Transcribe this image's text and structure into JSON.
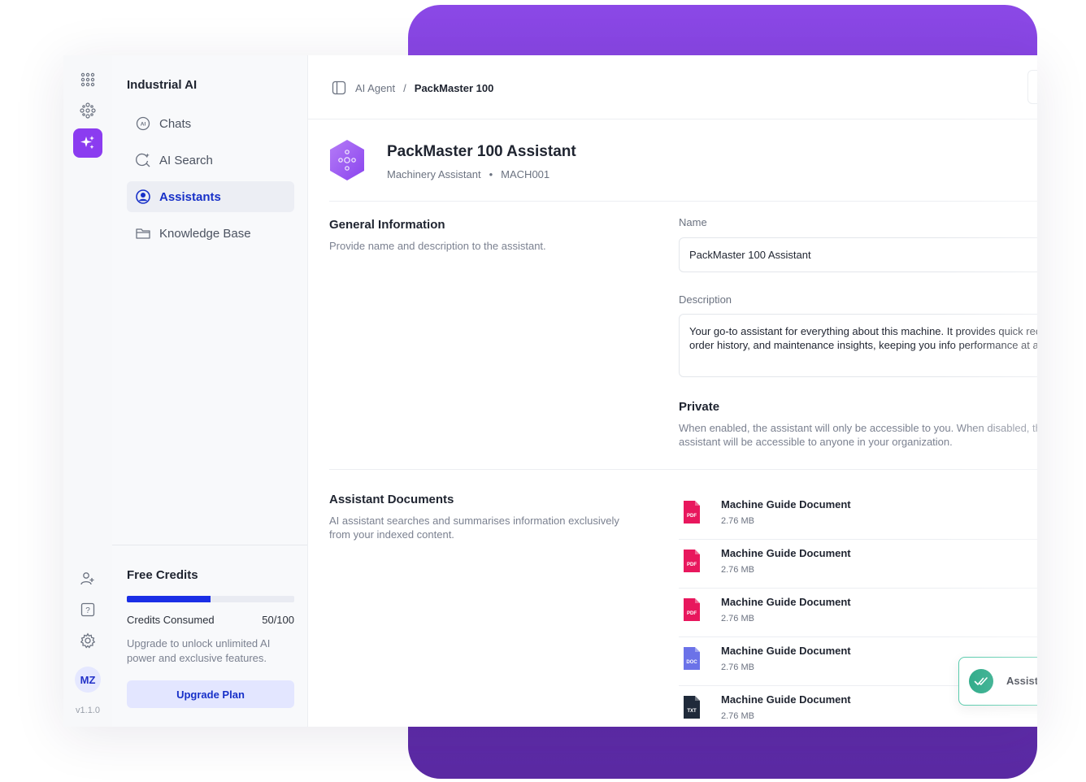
{
  "app": {
    "workspace": "Industrial AI",
    "version": "v1.1.0",
    "user_initials": "MZ",
    "accent": "#8b3cf0",
    "primary": "#1730c8"
  },
  "rail": {
    "icons": [
      "apps-grid-icon",
      "modules-icon",
      "sparkles-icon",
      "add-user-icon",
      "help-icon",
      "gear-icon"
    ]
  },
  "sidebar": {
    "items": [
      {
        "label": "Chats",
        "icon": "ai-chat-icon",
        "active": false
      },
      {
        "label": "AI Search",
        "icon": "ai-search-icon",
        "active": false
      },
      {
        "label": "Assistants",
        "icon": "assistant-user-icon",
        "active": true
      },
      {
        "label": "Knowledge Base",
        "icon": "folder-icon",
        "active": false
      }
    ]
  },
  "credits": {
    "title": "Free Credits",
    "label": "Credits Consumed",
    "used": 50,
    "total": 100,
    "display": "50/100",
    "note": "Upgrade to unlock unlimited AI power and exclusive features.",
    "button": "Upgrade Plan"
  },
  "breadcrumb": {
    "parent": "AI Agent",
    "separator": "/",
    "current": "PackMaster 100"
  },
  "assistant": {
    "title": "PackMaster 100 Assistant",
    "type": "Machinery Assistant",
    "dot": "•",
    "code": "MACH001"
  },
  "general": {
    "title": "General Information",
    "desc": "Provide name and description to the assistant.",
    "name_label": "Name",
    "name_value": "PackMaster 100 Assistant",
    "description_label": "Description",
    "description_value": "Your go-to assistant for everything about this machine. It provides quick records, work order history, and maintenance insights, keeping you info performance at any time.",
    "private_title": "Private",
    "private_desc": "When enabled, the assistant will only be accessible to you. When disabled, the assistant will be accessible to anyone in your organization."
  },
  "documents": {
    "title": "Assistant Documents",
    "desc": "AI assistant searches and summarises information exclusively from your indexed content.",
    "items": [
      {
        "name": "Machine Guide Document",
        "size": "2.76 MB",
        "type": "PDF",
        "color": "#e8175d"
      },
      {
        "name": "Machine Guide Document",
        "size": "2.76 MB",
        "type": "PDF",
        "color": "#e8175d"
      },
      {
        "name": "Machine Guide Document",
        "size": "2.76 MB",
        "type": "PDF",
        "color": "#e8175d"
      },
      {
        "name": "Machine Guide Document",
        "size": "2.76 MB",
        "type": "DOC",
        "color": "#6b72e8"
      },
      {
        "name": "Machine Guide Document",
        "size": "2.76 MB",
        "type": "TXT",
        "color": "#1f2a3a"
      }
    ]
  },
  "toast": {
    "text": "Assist"
  }
}
